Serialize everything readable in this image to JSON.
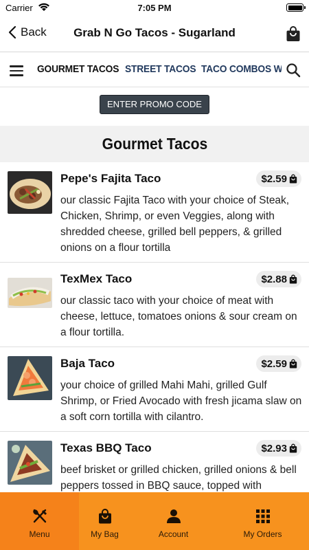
{
  "status_bar": {
    "carrier": "Carrier",
    "time": "7:05 PM"
  },
  "nav": {
    "back_label": "Back",
    "title": "Grab N Go Tacos - Sugarland"
  },
  "categories": {
    "tabs": [
      {
        "label": "GOURMET TACOS",
        "active": true
      },
      {
        "label": "STREET TACOS",
        "active": false
      },
      {
        "label": "TACO COMBOS W",
        "active": false
      }
    ]
  },
  "promo": {
    "label": "ENTER PROMO CODE"
  },
  "section": {
    "title": "Gourmet Tacos"
  },
  "items": [
    {
      "name": "Pepe's Fajita Taco",
      "price": "$2.59",
      "description": "our classic Fajita Taco with your choice of Steak, Chicken, Shrimp, or even Veggies, along with shredded cheese, grilled bell peppers, & grilled onions on a flour tortilla"
    },
    {
      "name": "TexMex Taco",
      "price": "$2.88",
      "description": "our classic taco with your choice of meat with cheese, lettuce, tomatoes onions & sour cream on a flour tortilla."
    },
    {
      "name": "Baja Taco",
      "price": "$2.59",
      "description": "your choice of grilled Mahi Mahi, grilled Gulf Shrimp, or Fried Avocado with fresh jicama slaw on a soft corn tortilla with cilantro."
    },
    {
      "name": "Texas BBQ Taco",
      "price": "$2.93",
      "description": "beef brisket or grilled chicken, grilled onions & bell peppers tossed in BBQ sauce, topped with"
    }
  ],
  "tab_bar": {
    "tabs": [
      {
        "label": "Menu",
        "icon": "utensils-icon",
        "active": true
      },
      {
        "label": "My Bag",
        "icon": "bag-icon",
        "active": false
      },
      {
        "label": "Account",
        "icon": "person-icon",
        "active": false
      },
      {
        "label": "My Orders",
        "icon": "grid-icon",
        "active": false
      }
    ]
  },
  "colors": {
    "accent": "#f7921e",
    "accent_active": "#f5821a",
    "promo_bg": "#3a434c",
    "section_bg": "#f1f1f1",
    "price_pill_bg": "#ececec"
  }
}
